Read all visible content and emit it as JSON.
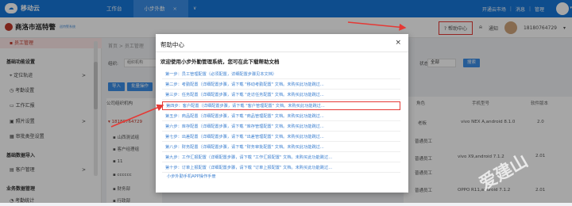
{
  "topbar": {
    "logo_text": "移动云",
    "tabs": [
      {
        "label": "工作台"
      },
      {
        "label": "小步外勤",
        "close": "×"
      }
    ],
    "caret": "∨",
    "right_links": [
      "开通云市场",
      "消息",
      "管理"
    ]
  },
  "header": {
    "brand": "商洛市巡特警",
    "brand_sub": "巡特警系统",
    "help": "帮助中心",
    "notify": "通知",
    "phone": "18180764729"
  },
  "sidebar": {
    "items": [
      {
        "label": "员工管理",
        "type": "first"
      },
      {
        "label": "基础功能设置",
        "type": "sec"
      },
      {
        "label": "定位轨迹",
        "arrow": ">"
      },
      {
        "label": "考勤设置",
        "arrow": ""
      },
      {
        "label": "工作汇报",
        "arrow": ""
      },
      {
        "label": "照片设置",
        "arrow": ">"
      },
      {
        "label": "审批类型设置",
        "arrow": ""
      },
      {
        "label": "基础数据导入",
        "type": "sec"
      },
      {
        "label": "客户管理",
        "arrow": ">"
      },
      {
        "label": "业务数据管理",
        "type": "sec"
      },
      {
        "label": "考勤统计",
        "arrow": ""
      }
    ]
  },
  "main": {
    "crumb": "首页 > 员工管理",
    "filter_label": "组织:",
    "filter_value": "组织机构",
    "import_btn": "导入",
    "batch_btn": "批量操作",
    "status_label": "状态:",
    "status_value": "全部",
    "search_btn": "搜索",
    "tree_header": "公司组织机构",
    "tree_items": [
      "18180764729",
      "山西测试组",
      "客户经理组",
      "11",
      "cccccc",
      "财务部",
      "行政部"
    ],
    "grid_headers": [
      "角色",
      "手机型号",
      "软件版本"
    ],
    "grid_rows": [
      [
        "老板",
        "vivo NEX A,android 8.1.0",
        "2.0"
      ],
      [
        "普通员工",
        "",
        ""
      ],
      [
        "普通员工",
        "vivo X9,android 7.1.2",
        "2.01"
      ],
      [
        "普通员工",
        "",
        ""
      ],
      [
        "普通员工",
        "OPPO R11,android 7.1.2",
        "2.01"
      ]
    ]
  },
  "modal": {
    "title": "帮助中心",
    "close": "×",
    "intro": "欢迎使用小步外勤管理系统，您可在此下载帮助文档",
    "steps": [
      "第一步：员工管理配置（必须配置，详细配置步骤见本文档）",
      "第二步：考勤配置（详细配置步骤，请下载 \"移动考勤配置\" 文档。未购买此功能跳过...",
      "第三步：任务配置（详细配置步骤，请下载 \"走访任务配置\" 文档。未购买此功能跳过...",
      "第四步：客户配置（详细配置步骤，请下载 \"客户管理配置\" 文档。未购买此功能跳过...",
      "第五步：商品配置（详细配置步骤，请下载 \"商品管理配置\" 文档。未购买此功能跳过...",
      "第六步：库存配置（详细配置步骤，请下载 \"库存管理配置\" 文档。未购买此功能跳过...",
      "第七步：出差配置（详细配置步骤，请下载 \"出差管理配置\" 文档。未购买此功能跳过...",
      "第八步：财务配置（详细配置步骤，请下载 \"财务审批配置\" 文档。未购买此功能跳过...",
      "第九步：工作汇报配置（详细配置步骤，请下载 \"工作汇报配置\" 文档。未购买此功能跳过...",
      "第十步：订单上报配置（详细配置步骤，请下载 \"订单上报配置\" 文档。未购买此功能跳过..."
    ],
    "manual": "小步外勤手机APP操作手册",
    "highlight_index": 3
  },
  "watermark": "爱建山",
  "colors": {
    "brand_blue": "#1677d9",
    "highlight_red": "#e53935",
    "link_blue": "#3b7fd0"
  }
}
